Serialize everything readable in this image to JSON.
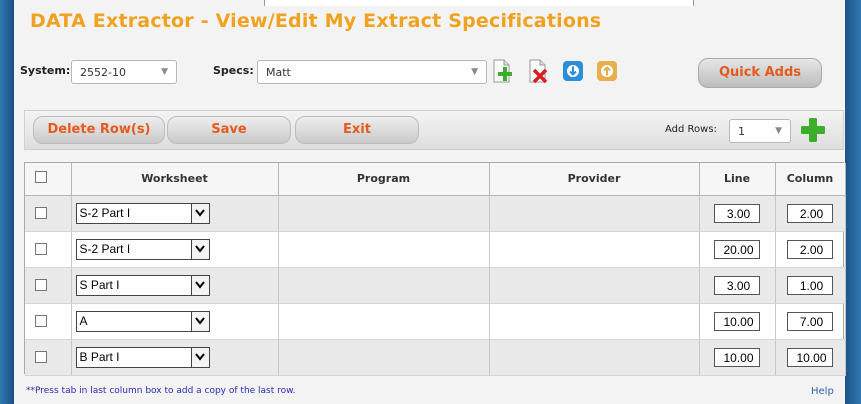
{
  "title": "DATA Extractor - View/Edit My Extract Specifications",
  "system": {
    "label": "System:",
    "value": "2552-10"
  },
  "specs": {
    "label": "Specs:",
    "value": "Matt"
  },
  "icons": [
    "add-spec-icon",
    "delete-spec-icon",
    "download-icon",
    "upload-icon"
  ],
  "quick_adds": "Quick Adds",
  "toolbar": {
    "delete_label": "Delete Row(s)",
    "save_label": "Save",
    "exit_label": "Exit",
    "add_rows_label": "Add Rows:",
    "add_rows_value": "1"
  },
  "columns": [
    "Worksheet",
    "Program",
    "Provider",
    "Line",
    "Column"
  ],
  "rows": [
    {
      "worksheet": "S-2 Part I",
      "program": "",
      "provider": "",
      "line": "3.00",
      "column": "2.00"
    },
    {
      "worksheet": "S-2 Part I",
      "program": "",
      "provider": "",
      "line": "20.00",
      "column": "2.00"
    },
    {
      "worksheet": "S Part I",
      "program": "",
      "provider": "",
      "line": "3.00",
      "column": "1.00"
    },
    {
      "worksheet": "A",
      "program": "",
      "provider": "",
      "line": "10.00",
      "column": "7.00"
    },
    {
      "worksheet": "B Part I",
      "program": "",
      "provider": "",
      "line": "10.00",
      "column": "10.00"
    }
  ],
  "footer_note": "**Press tab in last column box to add a copy of the last row.",
  "help_label": "Help",
  "colors": {
    "title": "#f0a21f",
    "button_text": "#e65a1e",
    "add_green": "#3dae2b",
    "link_blue": "#2a64b5"
  }
}
